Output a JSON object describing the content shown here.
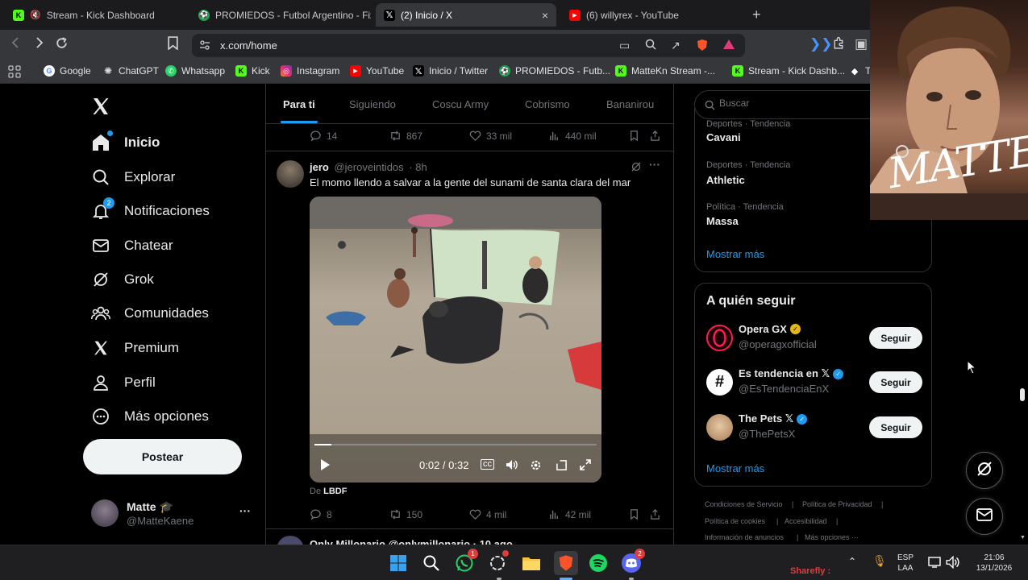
{
  "browser": {
    "tabs": [
      {
        "title": "Stream - Kick Dashboard",
        "icon": "kick-icon",
        "active": false
      },
      {
        "title": "PROMIEDOS - Futbol Argentino - Fixt",
        "icon": "promiedos-icon",
        "active": false
      },
      {
        "title": "(2) Inicio / X",
        "icon": "x-icon",
        "active": true,
        "close": "×"
      },
      {
        "title": "(6) willyrex - YouTube",
        "icon": "youtube-icon",
        "active": false
      }
    ],
    "new_tab": "+",
    "url": "x.com/home",
    "bookmarks": [
      {
        "label": "Google",
        "color": "#ea4335"
      },
      {
        "label": "ChatGPT",
        "color": "#555555"
      },
      {
        "label": "Whatsapp",
        "color": "#25d366"
      },
      {
        "label": "Kick",
        "color": "#53fc18"
      },
      {
        "label": "Instagram",
        "color": "#d6249f"
      },
      {
        "label": "YouTube",
        "color": "#ff0000"
      },
      {
        "label": "Inicio / Twitter",
        "color": "#000000"
      },
      {
        "label": "PROMIEDOS - Futb...",
        "color": "#1aa64b"
      },
      {
        "label": "MatteKn Stream -...",
        "color": "#53fc18"
      },
      {
        "label": "Stream - Kick Dashb...",
        "color": "#53fc18"
      },
      {
        "label": "T",
        "color": "#ffffff"
      }
    ]
  },
  "nav": {
    "items": [
      {
        "label": "Inicio",
        "icon": "home-icon",
        "bold": true
      },
      {
        "label": "Explorar",
        "icon": "search-icon"
      },
      {
        "label": "Notificaciones",
        "icon": "bell-icon",
        "badge": "2"
      },
      {
        "label": "Chatear",
        "icon": "mail-icon"
      },
      {
        "label": "Grok",
        "icon": "grok-icon"
      },
      {
        "label": "Comunidades",
        "icon": "communities-icon"
      },
      {
        "label": "Premium",
        "icon": "x-logo-icon"
      },
      {
        "label": "Perfil",
        "icon": "person-icon"
      },
      {
        "label": "Más opciones",
        "icon": "more-circle-icon"
      }
    ],
    "post_button": "Postear",
    "profile": {
      "name": "Matte 🎓",
      "handle": "@MatteKaene",
      "more": "···"
    }
  },
  "feed": {
    "tabs": [
      "Para ti",
      "Siguiendo",
      "Coscu Army",
      "Cobrismo",
      "Bananirou"
    ],
    "prev_tweet_actions": {
      "replies": "14",
      "retweets": "867",
      "likes": "33 mil",
      "views": "440 mil"
    },
    "tweet": {
      "name": "jero",
      "handle": "@jeroveintidos",
      "time": "· 8h",
      "text": "El momo llendo a salvar a la gente del sunami de santa clara del mar",
      "video_time": "0:02 / 0:32",
      "video_progress": 0.06,
      "source_prefix": "De",
      "source": "LBDF",
      "actions": {
        "replies": "8",
        "retweets": "150",
        "likes": "4 mil",
        "views": "42 mil"
      }
    },
    "next_tweet_peek": "Only Millonario  @onlymillonario · 10 ago"
  },
  "sidebar": {
    "search_placeholder": "Buscar",
    "trends": [
      {
        "meta": "Deportes · Tendencia",
        "name": "Cavani"
      },
      {
        "meta": "Deportes · Tendencia",
        "name": "Athletic"
      },
      {
        "meta": "Política · Tendencia",
        "name": "Massa"
      }
    ],
    "trends_more": "Mostrar más",
    "who_to_follow_title": "A quién seguir",
    "follow": [
      {
        "name": "Opera GX",
        "handle": "@operagxofficial",
        "verified": "gold",
        "button": "Seguir"
      },
      {
        "name": "Es tendencia en 𝕏",
        "handle": "@EsTendenciaEnX",
        "verified": "blue",
        "button": "Seguir"
      },
      {
        "name": "The Pets 𝕏",
        "handle": "@ThePetsX",
        "verified": "blue",
        "button": "Seguir"
      }
    ],
    "follow_more": "Mostrar más",
    "footer": [
      "Condiciones de Servicio",
      "Política de Privacidad",
      "Política de cookies",
      "Accesibilidad",
      "Información de anuncios",
      "Más opciones ···"
    ]
  },
  "webcam": {
    "overlay_text": "MATTE"
  },
  "taskbar": {
    "whatsapp_badge": "1",
    "discord_badge": "2",
    "lang": "ESP",
    "lang2": "LAA",
    "time": "21:06",
    "date": "13/1/2026",
    "sharefly": "Sharefly :"
  },
  "colors": {
    "accent": "#1d9bf0",
    "background": "#000000",
    "border": "#2f3336",
    "muted": "#71767b"
  }
}
